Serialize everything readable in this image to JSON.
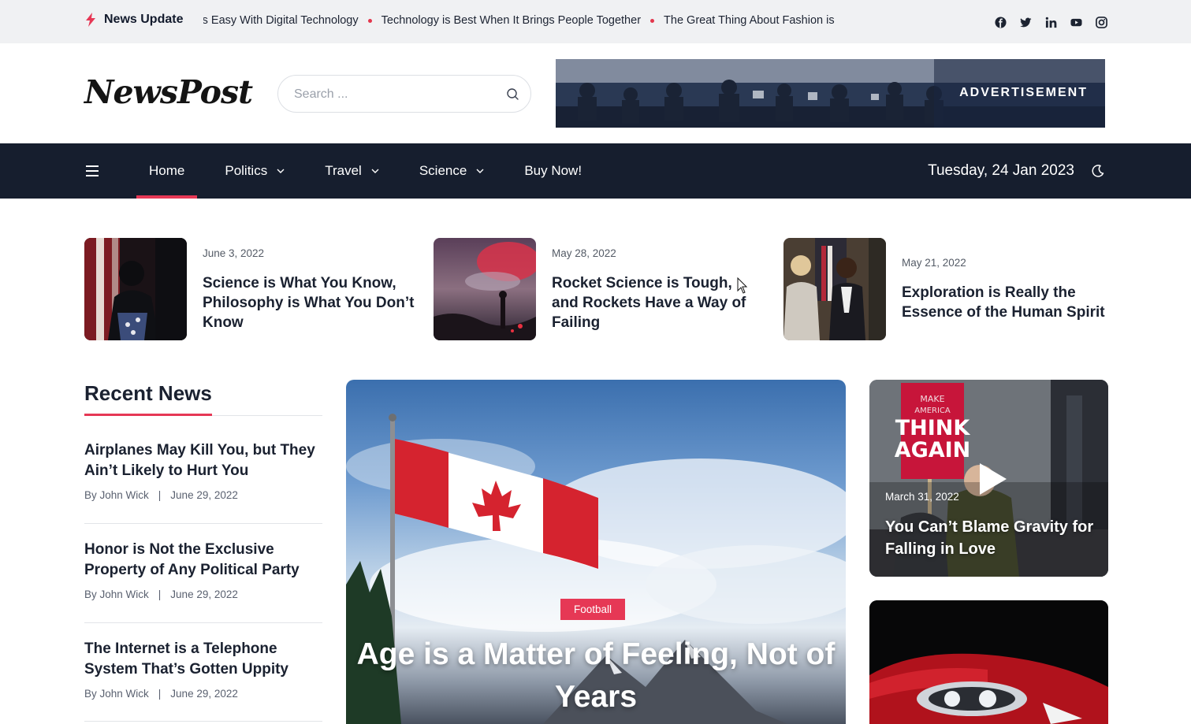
{
  "ticker": {
    "label": "News Update",
    "items": [
      "Life is Easy With Digital Technology",
      "Technology is Best When It Brings People Together",
      "The Great Thing About Fashion is"
    ]
  },
  "social_icons": [
    "facebook-icon",
    "twitter-icon",
    "linkedin-icon",
    "youtube-icon",
    "instagram-icon"
  ],
  "header": {
    "logo": "NewsPost",
    "search_placeholder": "Search ...",
    "ad_label": "ADVERTISEMENT"
  },
  "nav": {
    "items": [
      {
        "label": "Home",
        "active": true,
        "dropdown": false
      },
      {
        "label": "Politics",
        "active": false,
        "dropdown": true
      },
      {
        "label": "Travel",
        "active": false,
        "dropdown": true
      },
      {
        "label": "Science",
        "active": false,
        "dropdown": true
      },
      {
        "label": "Buy Now!",
        "active": false,
        "dropdown": false
      }
    ],
    "date": "Tuesday, 24 Jan 2023"
  },
  "featured": [
    {
      "date": "June 3, 2022",
      "title": "Science is What You Know, Philosophy is What You Don’t Know"
    },
    {
      "date": "May 28, 2022",
      "title": "Rocket Science is Tough, and Rockets Have a Way of Failing"
    },
    {
      "date": "May 21, 2022",
      "title": "Exploration is Really the Essence of the Human Spirit"
    }
  ],
  "recent": {
    "heading": "Recent News",
    "items": [
      {
        "title": "Airplanes May Kill You, but They Ain’t Likely to Hurt You",
        "author": "By John Wick",
        "date": "June 29, 2022"
      },
      {
        "title": "Honor is Not the Exclusive Property of Any Political Party",
        "author": "By John Wick",
        "date": "June 29, 2022"
      },
      {
        "title": "The Internet is a Telephone System That’s Gotten Uppity",
        "author": "By John Wick",
        "date": "June 29, 2022"
      }
    ]
  },
  "hero": {
    "category": "Football",
    "title": "Age is a Matter of Feeling, Not of Years"
  },
  "side": {
    "card1": {
      "sign_text": "MAKE AMERICA THINK AGAIN",
      "date": "March 31, 2022",
      "title": "You Can’t Blame Gravity for Falling in Love"
    }
  },
  "colors": {
    "accent": "#e63855",
    "nav_bg": "#161e2e",
    "topbar_bg": "#f0f1f3"
  }
}
